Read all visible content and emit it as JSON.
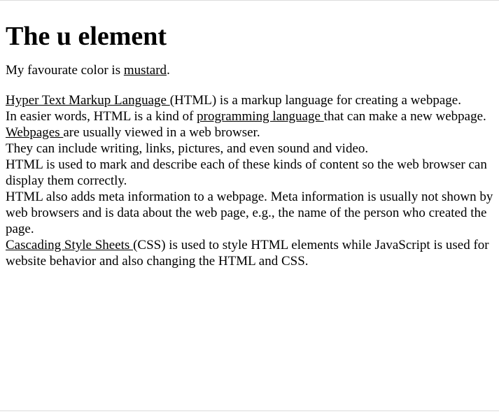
{
  "heading": "The u element",
  "sentence1": {
    "before": "My favourate color is ",
    "underlined": "mustard",
    "after": "."
  },
  "paragraph": {
    "l1_u": "Hyper Text Markup Language ",
    "l1_t": "(HTML) is a markup language for creating a webpage.",
    "l2_t": "In easier words, HTML is a kind of ",
    "l2_u": "programming language ",
    "l2_t2": "that can make a new webpage.",
    "l3_u": "Webpages ",
    "l3_t": "are usually viewed in a web browser.",
    "l4_t": "They can include writing, links, pictures, and even sound and video.",
    "l5_t": "HTML is used to mark and describe each of these kinds of content so the web browser can display them correctly.",
    "l6_t": "HTML also adds meta information to a webpage. Meta information is usually not shown by web browsers and is data about the web page, e.g., the name of the person who created the page.",
    "l7_u": "Cascading Style Sheets ",
    "l7_t": "(CSS) is used to style HTML elements while JavaScript is used for website behavior and also changing the HTML and CSS."
  }
}
